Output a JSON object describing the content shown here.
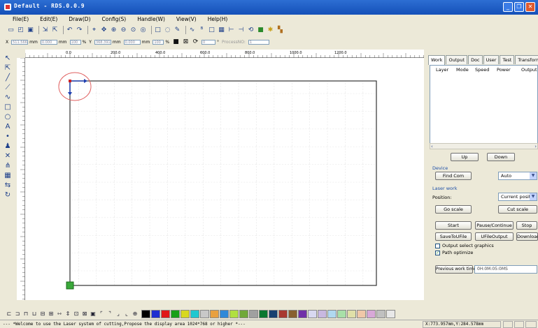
{
  "window": {
    "title": "Default - RDS.0.0.9"
  },
  "menu": [
    "File(E)",
    "Edit(E)",
    "Draw(D)",
    "Config(S)",
    "Handle(W)",
    "View(V)",
    "Help(H)"
  ],
  "toolbar_icons": [
    "new-file-icon",
    "open-file-icon",
    "save-icon",
    "import-icon",
    "export-icon",
    "undo-icon",
    "redo-icon",
    "select-icon",
    "pan-icon",
    "zoom-in-icon",
    "zoom-out-icon",
    "zoom-window-icon",
    "zoom-fit-icon",
    "rectangle-select-icon",
    "node-edit-icon",
    "draw-icon",
    "curve-icon",
    "text-tool-icon",
    "frame-icon",
    "align-icon",
    "distribute-icon",
    "mirror-icon",
    "rotate-icon",
    "laser-icon",
    "settings-icon",
    "output-icon"
  ],
  "propbar": {
    "x_label": "X",
    "x_value": "511.566",
    "y_label": "Y",
    "y_value": "368.391",
    "w_value": "0.000",
    "h_value": "0.000",
    "unit": "mm",
    "sx_value": "100",
    "sy_value": "100",
    "percent": "%",
    "angle_value": "0",
    "degree": "°",
    "process_label": "ProcessNO:",
    "process_value": "1"
  },
  "ruler": {
    "top_ticks": [
      "0.0",
      "200.0",
      "400.0",
      "600.0",
      "800.0",
      "1000.0",
      "1200.0"
    ]
  },
  "left_tools": [
    "pointer-icon",
    "node-icon",
    "line-icon",
    "polyline-icon",
    "curve-icon",
    "rectangle-icon",
    "ellipse-icon",
    "text-icon",
    "dot-icon",
    "user-icon",
    "delete-icon",
    "array-icon",
    "grid-icon",
    "offset-icon",
    "rotate-icon"
  ],
  "panel": {
    "tabs": [
      "Work",
      "Output",
      "Doc",
      "User",
      "Test",
      "Transform"
    ],
    "active_tab": "Work",
    "layer_headers": [
      "Layer",
      "Mode",
      "Speed",
      "Power",
      "Output"
    ],
    "up_button": "Up",
    "down_button": "Down",
    "device_section": "Device",
    "find_com_button": "Find Com",
    "com_select": "Auto",
    "laser_work_section": "Laser work",
    "position_label": "Position:",
    "position_select": "Current positic",
    "go_scale_button": "Go scale",
    "cut_scale_button": "Cut scale",
    "start_button": "Start",
    "pause_button": "Pause/Continue",
    "stop_button": "Stop",
    "save_file_button": "SaveToUFile",
    "ufile_output_button": "UFileOutput",
    "download_button": "Download",
    "output_select_graphics": "Output select graphics",
    "output_select_checked": false,
    "path_optimize": "Path optimize",
    "path_optimize_checked": true,
    "prev_work_time_label": "Previous work time",
    "prev_work_time_value": "0H:0M:05:0MS"
  },
  "palette_colors": [
    "#000000",
    "#1f2fd0",
    "#e01818",
    "#18a018",
    "#d8d820",
    "#20c8d0",
    "#c8c8c8",
    "#e8a040",
    "#3088d8",
    "#b0e040",
    "#70a838",
    "#a0a0a0",
    "#0a7830",
    "#184070",
    "#a83830",
    "#886030",
    "#7030a8",
    "#d8d8f0",
    "#c8b8e0",
    "#b0d8f0",
    "#a8e0a8",
    "#e0e0a8",
    "#f0c8a8",
    "#d8a8d8",
    "#c0c0c0",
    "#e8e8e8"
  ],
  "status": {
    "message": "--- *Welcome to use the Laser system of cutting,Propose the display area 1024*768 or higher *---",
    "coords": "X:773.957mm,Y:284.578mm"
  }
}
